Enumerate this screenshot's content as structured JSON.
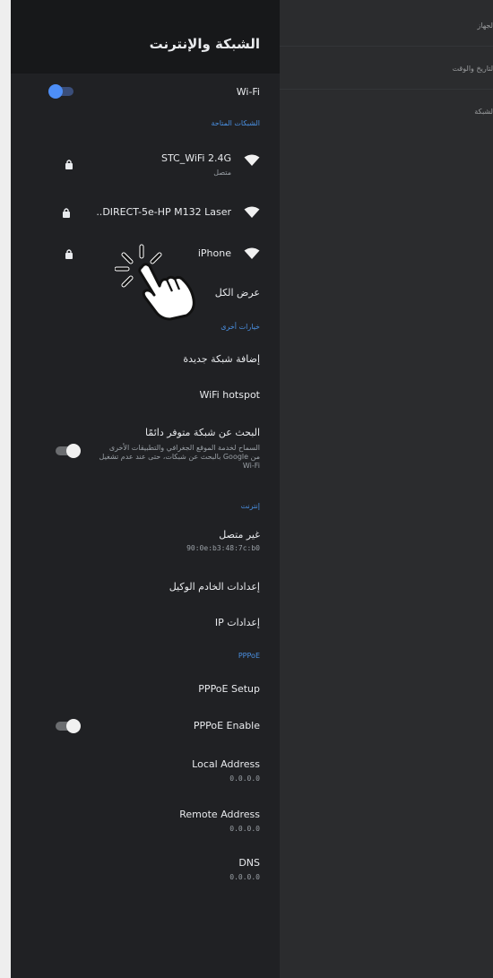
{
  "header": {
    "title": "الشبكة والإنترنت"
  },
  "wifi": {
    "label": "Wi-Fi",
    "enabled": true
  },
  "available_networks": {
    "section_label": "الشبكات المتاحة",
    "items": [
      {
        "ssid": "STC_WiFi 2.4G",
        "status": "متصل",
        "locked": true
      },
      {
        "ssid": "DIRECT-5e-HP M132 Laser..",
        "status": "",
        "locked": true
      },
      {
        "ssid": "iPhone",
        "status": "",
        "locked": true
      }
    ],
    "see_all": "عرض الكل"
  },
  "other_options": {
    "section_label": "خيارات أخرى",
    "add_network": "إضافة شبكة جديدة",
    "hotspot": "WiFi hotspot",
    "scanning": {
      "title": "البحث عن شبكة متوفر دائمًا",
      "desc_line1": "السماح لخدمة الموقع الجغرافي والتطبيقات الأخرى",
      "desc_line2": "من Google بالبحث عن شبكات، حتى عند عدم تشغيل",
      "desc_line3": "Wi-Fi",
      "enabled": false
    }
  },
  "internet": {
    "section_label": "إنترنت",
    "status_title": "غير متصل",
    "mac": "90:0e:b3:48:7c:b0",
    "proxy": "إعدادات الخادم الوكيل",
    "ip": "إعدادات IP"
  },
  "pppoe": {
    "section_label": "PPPoE",
    "setup": "PPPoE Setup",
    "enable_label": "PPPoE Enable",
    "enabled": false,
    "local_label": "Local Address",
    "local_value": "0.0.0.0",
    "remote_label": "Remote Address",
    "remote_value": "0.0.0.0",
    "dns_label": "DNS",
    "dns_value": "0.0.0.0"
  },
  "right_menu": {
    "items": [
      "لجهاز",
      "لتاريخ والوقت",
      "لشبكة"
    ]
  },
  "colors": {
    "panel_bg": "#202124",
    "header_bg": "#17181a",
    "accent": "#4a90e2",
    "toggle_on": "#4d8ef7"
  }
}
